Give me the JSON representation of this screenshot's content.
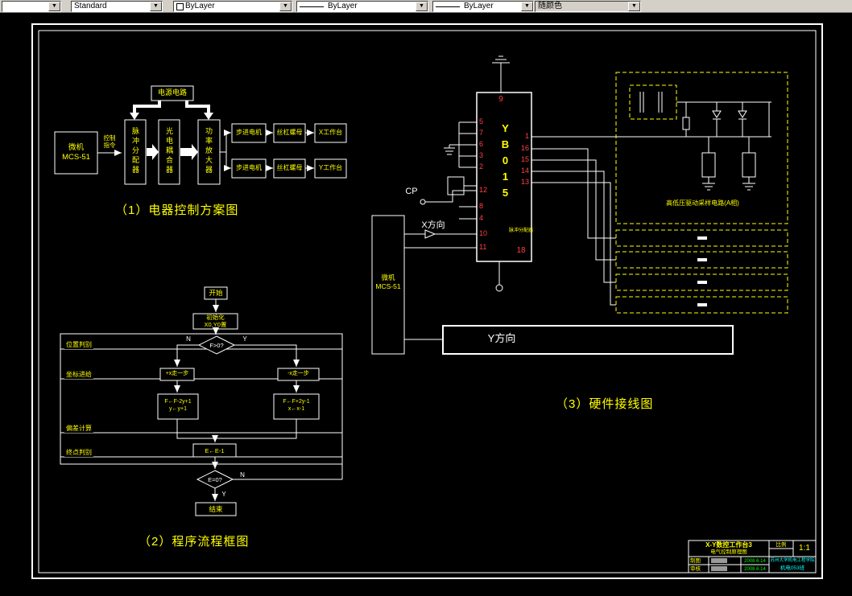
{
  "toolbar": {
    "combos": [
      "",
      "Standard",
      "ByLayer",
      "ByLayer",
      "ByLayer",
      "随颜色"
    ]
  },
  "diagram1": {
    "caption": "（1）电器控制方案图",
    "power_box": "电源电路",
    "mcu": "微机\nMCS-51",
    "cmd_label": "控制\n指令",
    "box_pulse": "脉冲分配器",
    "box_opto": "光电耦合器",
    "box_amp": "功率放大器",
    "row1_motor": "步进电机",
    "row1_screw": "丝杠螺母",
    "row1_table": "X工作台",
    "row2_motor": "步进电机",
    "row2_screw": "丝杠螺母",
    "row2_table": "Y工作台"
  },
  "diagram2": {
    "caption": "（2）程序流程框图",
    "start": "开始",
    "init": "初始化\nX0,Y0置",
    "decision1": "F>0?",
    "label_n1": "N",
    "label_y1": "Y",
    "step_plus": "+x走一步",
    "step_minus": "-x走一步",
    "calc_left": "F←F-2y+1\ny←y+1",
    "calc_right": "F←F+2y-1\nx←x-1",
    "counter": "E←E-1",
    "decision2": "E=0?",
    "label_n2": "N",
    "label_y2": "Y",
    "end": "结束",
    "phase_labels": [
      "位置判别",
      "坐标进给",
      "偏差计算",
      "终点判别"
    ]
  },
  "diagram3": {
    "caption": "（3）硬件接线图",
    "cp": "CP",
    "x_dir": "X方向",
    "y_dir": "Y方向",
    "mcu": "微机\nMCS-51",
    "chip_name": "YB015",
    "chip_sub": "脉冲分配器",
    "pin_top": "9",
    "pin_bottom": "18",
    "pins_left": [
      "5",
      "7",
      "6",
      "3",
      "2",
      "12",
      "8",
      "4",
      "10",
      "11"
    ],
    "pins_right": [
      "1",
      "16",
      "15",
      "14",
      "13"
    ],
    "a_phase_label": "高低压驱动采样电路(A相)"
  },
  "titleblock": {
    "title_line1": "X-Y数控工作台3",
    "title_line2": "电气控制原理图",
    "scale_label": "比例",
    "scale_value": "1:1",
    "drawn_label": "制图",
    "checked_label": "审核",
    "drawn_date": "2008.6.14",
    "checked_date": "2008.6.14",
    "org_line1": "苏州大学机电工程学院",
    "org_line2": "机电053班"
  }
}
